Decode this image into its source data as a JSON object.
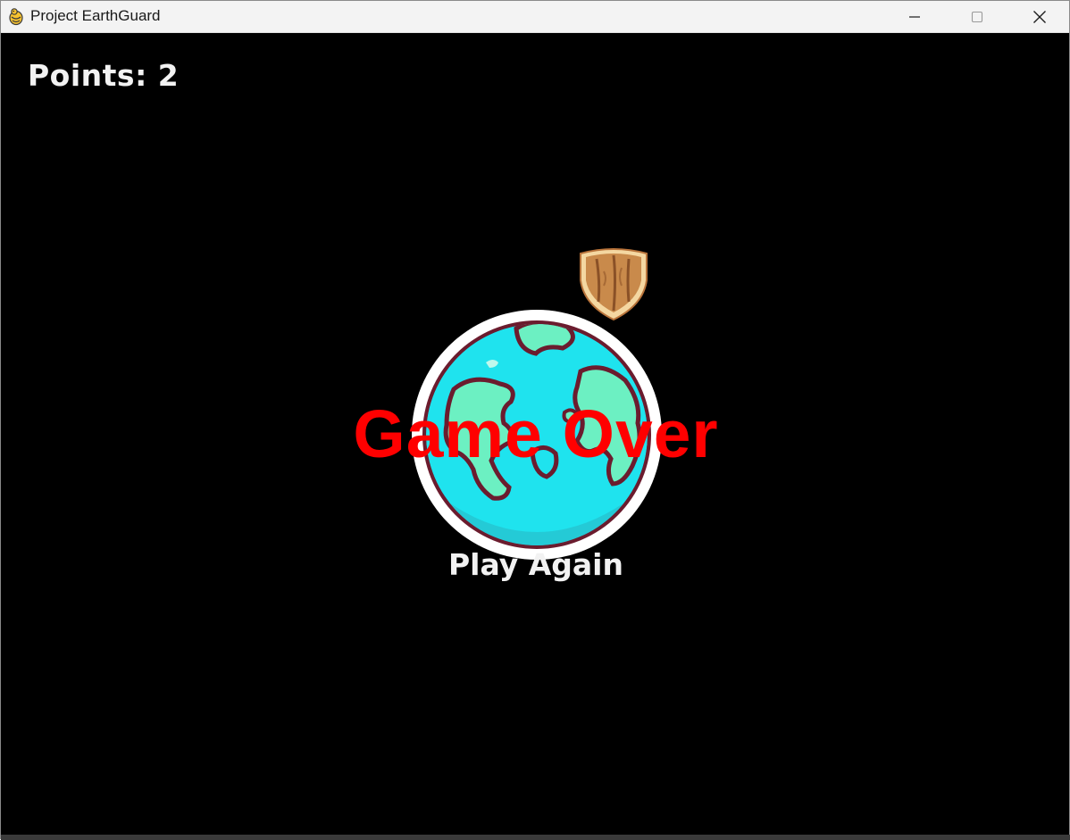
{
  "window": {
    "title": "Project EarthGuard",
    "icons": {
      "app": "pygame-snake-icon",
      "minimize": "minimize-icon",
      "maximize": "maximize-icon",
      "close": "close-icon"
    }
  },
  "hud": {
    "points_label": "Points: 2"
  },
  "overlay": {
    "game_over_text": "Game Over",
    "play_again_label": "Play Again"
  },
  "sprites": {
    "earth": "earth-globe-icon",
    "shield": "wooden-shield-icon"
  },
  "colors": {
    "background": "#000000",
    "game_over": "#ff0000",
    "hud_text": "#f2f2f2",
    "ocean": "#1fe3ee",
    "land": "#6cf0c2",
    "outline": "#6b1c2e",
    "shield_wood": "#c98a4b",
    "shield_rim": "#f4d7a1"
  }
}
